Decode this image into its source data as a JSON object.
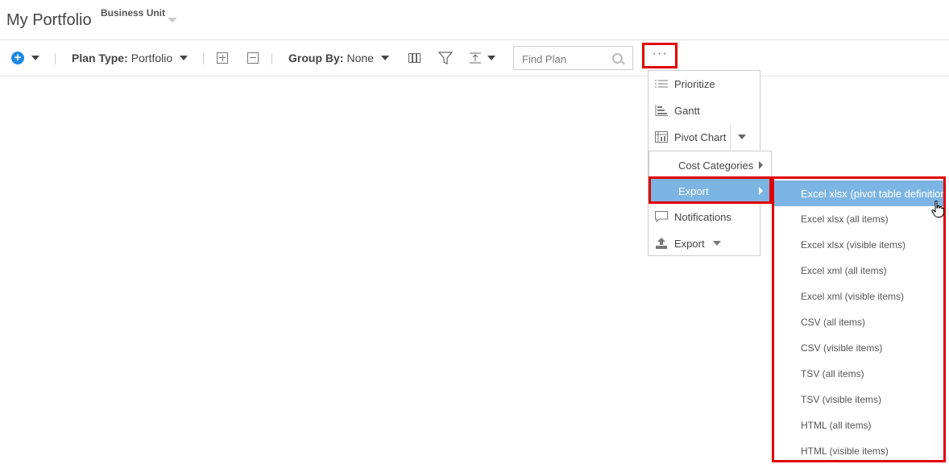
{
  "header": {
    "title": "My Portfolio",
    "business_unit": "Business Unit"
  },
  "toolbar": {
    "plan_type_label": "Plan Type:",
    "plan_type_value": "Portfolio",
    "group_by_label": "Group By:",
    "group_by_value": "None",
    "more_label": "···"
  },
  "search": {
    "placeholder": "Find Plan",
    "value": ""
  },
  "menu": {
    "items": [
      {
        "label": "Prioritize",
        "icon": "list-icon"
      },
      {
        "label": "Gantt",
        "icon": "gantt-icon"
      },
      {
        "label": "Pivot Chart",
        "icon": "pivot-chart-icon"
      },
      {
        "label": "Notifications",
        "icon": "comment-icon"
      },
      {
        "label": "Export",
        "icon": "upload-icon"
      }
    ]
  },
  "submenu": {
    "items": [
      {
        "label": "Cost Categories"
      },
      {
        "label": "Export"
      }
    ]
  },
  "export_menu": {
    "items": [
      {
        "label": "Excel xlsx (pivot table definition"
      },
      {
        "label": "Excel xlsx (all items)"
      },
      {
        "label": "Excel xlsx (visible items)"
      },
      {
        "label": "Excel xml (all items)"
      },
      {
        "label": "Excel xml (visible items)"
      },
      {
        "label": "CSV (all items)"
      },
      {
        "label": "CSV (visible items)"
      },
      {
        "label": "TSV (all items)"
      },
      {
        "label": "TSV (visible items)"
      },
      {
        "label": "HTML (all items)"
      },
      {
        "label": "HTML (visible items)"
      }
    ]
  },
  "colors": {
    "accent": "#1e88e5",
    "highlight": "#7cb5e4",
    "annotation": "#e00000"
  }
}
